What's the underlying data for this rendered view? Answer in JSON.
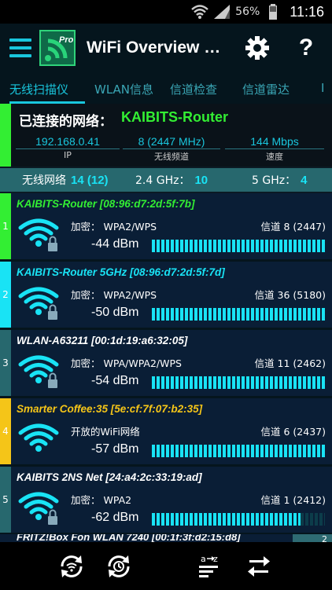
{
  "status_bar": {
    "battery_percent": "56%",
    "time": "11:16"
  },
  "app_bar": {
    "title": "WiFi Overview 3…",
    "logo_text": "Pro"
  },
  "tabs": [
    {
      "label": "无线扫描仪",
      "active": true
    },
    {
      "label": "WLAN信息",
      "active": false
    },
    {
      "label": "信道检查",
      "active": false
    },
    {
      "label": "信道雷达",
      "active": false
    },
    {
      "label": "I",
      "active": false
    }
  ],
  "connected": {
    "label": "已连接的网络：",
    "ssid": "KAIBITS-Router",
    "ip": {
      "value": "192.168.0.41",
      "caption": "IP"
    },
    "channel": {
      "value": "8 (2447 MHz)",
      "caption": "无线频道"
    },
    "speed": {
      "value": "144 Mbps",
      "caption": "速度"
    }
  },
  "summary": {
    "networks_label": "无线网络",
    "networks_value": "14 (12)",
    "ghz24_label": "2.4 GHz：",
    "ghz24_value": "10",
    "ghz5_label": "5 GHz：",
    "ghz5_value": "4"
  },
  "networks": [
    {
      "index": "1",
      "ssid": "KAIBITS-Router [08:96:d7:2d:5f:7b]",
      "ssid_color": "#33ee33",
      "strip_color": "#33ee33",
      "encryption": "加密：  WPA2/WPS",
      "channel": "信道 8 (2447)",
      "dbm": "-44  dBm",
      "signal_level": 1.0,
      "icon_color": "#19e3f5",
      "locked": true
    },
    {
      "index": "2",
      "ssid": "KAIBITS-Router 5GHz [08:96:d7:2d:5f:7d]",
      "ssid_color": "#19e3f5",
      "strip_color": "#19e3f5",
      "encryption": "加密：  WPA2/WPS",
      "channel": "信道 36 (5180)",
      "dbm": "-50  dBm",
      "signal_level": 1.0,
      "icon_color": "#19e3f5",
      "locked": true
    },
    {
      "index": "3",
      "ssid": "WLAN-A63211 [00:1d:19:a6:32:05]",
      "ssid_color": "#ffffff",
      "strip_color": "#27686e",
      "encryption": "加密：  WPA/WPA2/WPS",
      "channel": "信道 11 (2462)",
      "dbm": "-54  dBm",
      "signal_level": 1.0,
      "icon_color": "#19e3f5",
      "locked": true
    },
    {
      "index": "4",
      "ssid": "Smarter Coffee:35 [5e:cf:7f:07:b2:35]",
      "ssid_color": "#f5c518",
      "strip_color": "#f5c518",
      "encryption": "开放的WiFi网络",
      "channel": "信道 6 (2437)",
      "dbm": "-57  dBm",
      "signal_level": 1.0,
      "icon_color": "#19e3f5",
      "locked": false
    },
    {
      "index": "5",
      "ssid": "KAIBITS 2NS Net [24:a4:2c:33:19:ad]",
      "ssid_color": "#ffffff",
      "strip_color": "#27686e",
      "encryption": "加密：  WPA2",
      "channel": "信道 1 (2412)",
      "dbm": "-62  dBm",
      "signal_level": 0.86,
      "icon_color": "#19e3f5",
      "locked": true
    }
  ],
  "peek_item": {
    "ssid": "FRITZ!Box Fon WLAN 7240 [00:1f:3f:d2:15:d8]",
    "badge": "2"
  },
  "icons": {
    "menu": "hamburger-icon",
    "settings": "gear-icon",
    "help": "question-icon",
    "refresh": "refresh-icon",
    "timer": "timer-refresh-icon",
    "sort": "sort-az-icon",
    "swap": "swap-icon"
  }
}
